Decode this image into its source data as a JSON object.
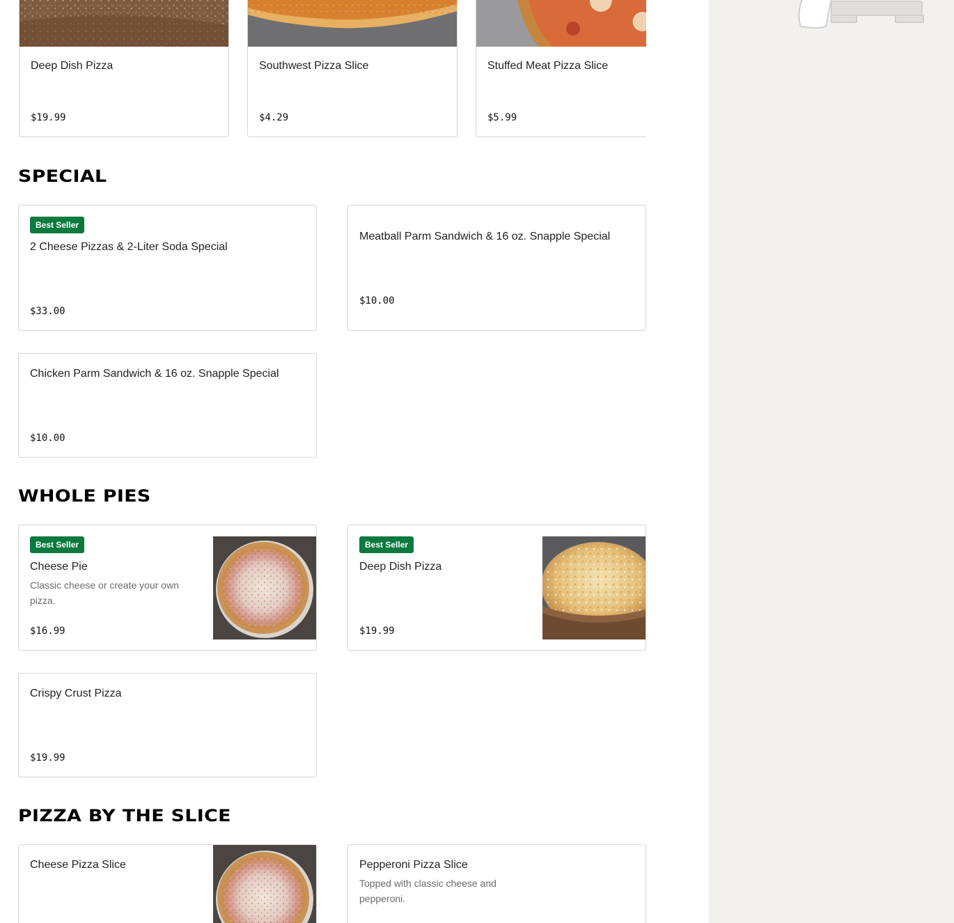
{
  "carousel": {
    "items": [
      {
        "name": "Deep Dish Pizza",
        "price": "$19.99",
        "image": "deep-dish-pizza-image"
      },
      {
        "name": "Southwest Pizza Slice",
        "price": "$4.29",
        "image": "southwest-pizza-image"
      },
      {
        "name": "Stuffed Meat Pizza Slice",
        "price": "$5.99",
        "image": "stuffed-meat-pizza-image"
      }
    ]
  },
  "sections": {
    "special": {
      "title": "SPECIAL",
      "items": [
        {
          "badge": "Best Seller",
          "name": "2 Cheese Pizzas & 2-Liter Soda Special",
          "price": "$33.00"
        },
        {
          "name": "Meatball Parm Sandwich & 16 oz. Snapple Special",
          "price": "$10.00"
        },
        {
          "name": "Chicken Parm Sandwich & 16 oz. Snapple Special",
          "price": "$10.00"
        }
      ]
    },
    "whole_pies": {
      "title": "WHOLE PIES",
      "items": [
        {
          "badge": "Best Seller",
          "name": "Cheese Pie",
          "description": "Classic cheese or create your own pizza.",
          "price": "$16.99",
          "image": "cheese-pie-image"
        },
        {
          "badge": "Best Seller",
          "name": "Deep Dish Pizza",
          "price": "$19.99",
          "image": "deep-dish-pizza-image"
        },
        {
          "name": "Crispy Crust Pizza",
          "price": "$19.99"
        }
      ]
    },
    "by_the_slice": {
      "title": "PIZZA BY THE SLICE",
      "items": [
        {
          "name": "Cheese Pizza Slice",
          "image": "cheese-slice-image"
        },
        {
          "name": "Pepperoni Pizza Slice",
          "description": "Topped with classic cheese and pepperoni."
        }
      ]
    }
  },
  "colors": {
    "badge_green": "#0b7a3e",
    "cart_panel_bg": "#f2f1ee",
    "card_border": "#d6d6d6"
  }
}
